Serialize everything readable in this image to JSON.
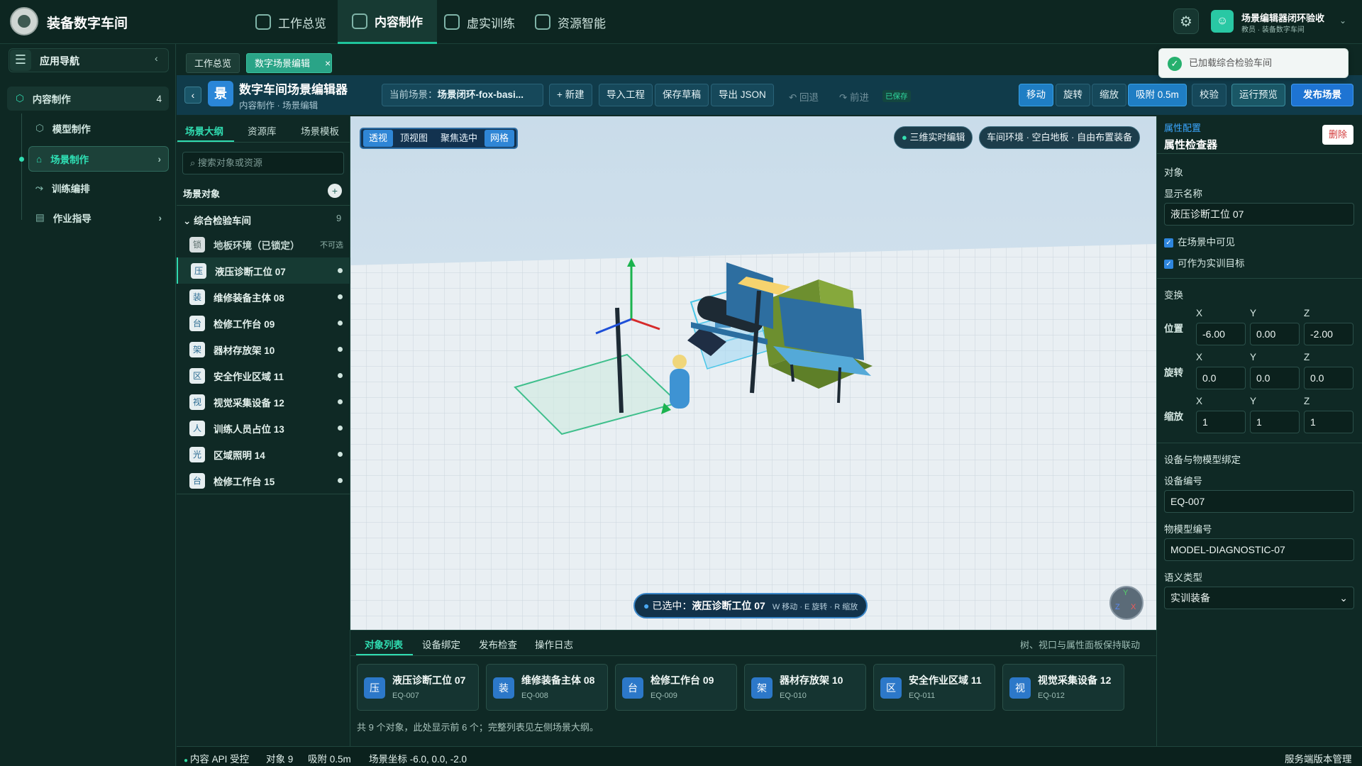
{
  "app": {
    "title": "装备数字车间"
  },
  "topnav": [
    {
      "label": "工作总览"
    },
    {
      "label": "内容制作"
    },
    {
      "label": "虚实训练"
    },
    {
      "label": "资源智能"
    }
  ],
  "user": {
    "name": "场景编辑器闭环验收",
    "role": "教员 · 装备数字车间"
  },
  "toast": {
    "text": "已加载综合检验车间"
  },
  "leftnav": {
    "header": "应用导航",
    "group": {
      "label": "内容制作",
      "count": "4"
    },
    "items": [
      {
        "label": "模型制作"
      },
      {
        "label": "场景制作"
      },
      {
        "label": "训练编排"
      },
      {
        "label": "作业指导"
      }
    ]
  },
  "tabs": [
    {
      "label": "工作总览"
    },
    {
      "label": "数字场景编辑"
    }
  ],
  "editor": {
    "badge": "景",
    "title": "数字车间场景编辑器",
    "breadcrumb": "内容制作 · 场景编辑",
    "scene_label": "当前场景：",
    "scene_name": "场景闭环-fox-basi...",
    "btn_new": "+ 新建",
    "btn_import": "导入工程",
    "btn_save": "保存草稿",
    "btn_export": "导出 JSON",
    "btn_undo": "↶ 回退",
    "btn_redo": "↷ 前进",
    "saved": "已保存",
    "btn_move": "移动",
    "btn_rotate": "旋转",
    "btn_scale": "缩放",
    "btn_snap": "吸附 0.5m",
    "btn_verify": "校验",
    "btn_preview": "运行预览",
    "btn_publish": "发布场景"
  },
  "outline": {
    "tabs": [
      "场景大纲",
      "资源库",
      "场景模板"
    ],
    "search_placeholder": "搜索对象或资源",
    "section": "场景对象",
    "group": {
      "label": "综合检验车间",
      "count": "9"
    },
    "locked": {
      "badge": "锁",
      "label": "地板环境（已锁定）",
      "note": "不可选"
    },
    "items": [
      {
        "badge": "压",
        "label": "液压诊断工位 07"
      },
      {
        "badge": "装",
        "label": "维修装备主体 08"
      },
      {
        "badge": "台",
        "label": "检修工作台 09"
      },
      {
        "badge": "架",
        "label": "器材存放架 10"
      },
      {
        "badge": "区",
        "label": "安全作业区域 11"
      },
      {
        "badge": "视",
        "label": "视觉采集设备 12"
      },
      {
        "badge": "人",
        "label": "训练人员占位 13"
      },
      {
        "badge": "光",
        "label": "区域照明 14"
      },
      {
        "badge": "台",
        "label": "检修工作台 15"
      }
    ]
  },
  "viewport": {
    "views": [
      "透视",
      "顶视图",
      "聚焦选中",
      "网格"
    ],
    "mode_pill": "三维实时编辑",
    "env_pill": "车间环境 · 空白地板 · 自由布置装备",
    "selected_label": "已选中：",
    "selected_name": "液压诊断工位 07",
    "hint": "W 移动 · E 旋转 · R 缩放",
    "axes": {
      "y": "Y",
      "z": "Z",
      "x": "X"
    }
  },
  "bottom": {
    "tabs": [
      "对象列表",
      "设备绑定",
      "发布检查",
      "操作日志"
    ],
    "hint": "树、视口与属性面板保持联动",
    "cards": [
      {
        "badge": "压",
        "name": "液压诊断工位 07",
        "code": "EQ-007"
      },
      {
        "badge": "装",
        "name": "维修装备主体 08",
        "code": "EQ-008"
      },
      {
        "badge": "台",
        "name": "检修工作台 09",
        "code": "EQ-009"
      },
      {
        "badge": "架",
        "name": "器材存放架 10",
        "code": "EQ-010"
      },
      {
        "badge": "区",
        "name": "安全作业区域 11",
        "code": "EQ-011"
      },
      {
        "badge": "视",
        "name": "视觉采集设备 12",
        "code": "EQ-012"
      }
    ],
    "summary": "共 9 个对象，此处显示前 6 个；完整列表见左侧场景大纲。"
  },
  "props": {
    "title_small": "属性配置",
    "title": "属性检查器",
    "delete": "删除",
    "object": "对象",
    "display_name_label": "显示名称",
    "display_name": "液压诊断工位 07",
    "visible_label": "在场景中可见",
    "target_label": "可作为实训目标",
    "transform": "变换",
    "axis_x": "X",
    "axis_y": "Y",
    "axis_z": "Z",
    "pos_label": "位置",
    "pos": [
      "-6.00",
      "0.00",
      "-2.00"
    ],
    "rot_label": "旋转",
    "rot": [
      "0.0",
      "0.0",
      "0.0"
    ],
    "scale_label": "缩放",
    "scale": [
      "1",
      "1",
      "1"
    ],
    "binding": "设备与物模型绑定",
    "device_label": "设备编号",
    "device": "EQ-007",
    "model_label": "物模型编号",
    "model": "MODEL-DIAGNOSTIC-07",
    "semantic_label": "语义类型",
    "semantic": "实训装备"
  },
  "status": {
    "api": "内容 API 受控",
    "objects": "对象 9",
    "snap": "吸附 0.5m",
    "coords": "场景坐标 -6.0, 0.0, -2.0",
    "right": "服务端版本管理"
  },
  "colors": {
    "accent": "#30dbb0",
    "primary": "#1f7ec4",
    "bg": "#0f2925"
  }
}
